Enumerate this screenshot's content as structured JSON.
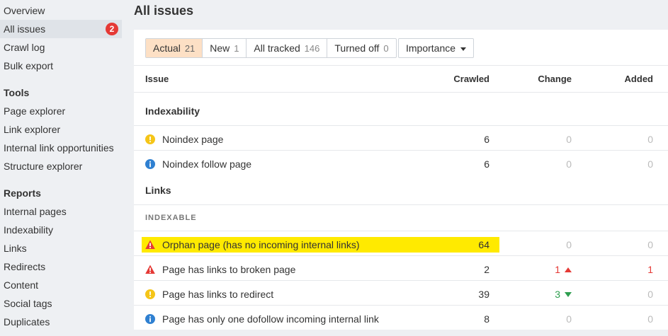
{
  "sidebar": {
    "items_top": [
      {
        "label": "Overview"
      },
      {
        "label": "All issues",
        "badge": "2",
        "active": true
      },
      {
        "label": "Crawl log"
      },
      {
        "label": "Bulk export"
      }
    ],
    "tools_heading": "Tools",
    "tools": [
      {
        "label": "Page explorer"
      },
      {
        "label": "Link explorer"
      },
      {
        "label": "Internal link opportunities"
      },
      {
        "label": "Structure explorer"
      }
    ],
    "reports_heading": "Reports",
    "reports": [
      {
        "label": "Internal pages"
      },
      {
        "label": "Indexability"
      },
      {
        "label": "Links"
      },
      {
        "label": "Redirects"
      },
      {
        "label": "Content"
      },
      {
        "label": "Social tags"
      },
      {
        "label": "Duplicates"
      }
    ]
  },
  "page_title": "All issues",
  "tabs": [
    {
      "label": "Actual",
      "count": "21",
      "active": true
    },
    {
      "label": "New",
      "count": "1"
    },
    {
      "label": "All tracked",
      "count": "146"
    },
    {
      "label": "Turned off",
      "count": "0"
    }
  ],
  "importance_label": "Importance",
  "table": {
    "headers": {
      "issue": "Issue",
      "crawled": "Crawled",
      "change": "Change",
      "added": "Added"
    },
    "sections": [
      {
        "title": "Indexability"
      },
      {
        "title": "Links",
        "subhead": "INDEXABLE"
      }
    ],
    "rows": [
      {
        "icon": "warning-yellow-icon",
        "issue": "Noindex page",
        "crawled": "6",
        "change": "0",
        "added": "0"
      },
      {
        "icon": "info-blue-icon",
        "issue": "Noindex follow page",
        "crawled": "6",
        "change": "0",
        "added": "0"
      },
      {
        "icon": "error-red-icon",
        "issue": "Orphan page (has no incoming internal links)",
        "crawled": "64",
        "change": "0",
        "added": "0",
        "highlighted": true
      },
      {
        "icon": "error-red-icon",
        "issue": "Page has links to broken page",
        "crawled": "2",
        "change": "1",
        "change_dir": "up",
        "added": "1"
      },
      {
        "icon": "warning-yellow-icon",
        "issue": "Page has links to redirect",
        "crawled": "39",
        "change": "3",
        "change_dir": "down",
        "added": "0"
      },
      {
        "icon": "info-blue-icon",
        "issue": "Page has only one dofollow incoming internal link",
        "crawled": "8",
        "change": "0",
        "added": "0"
      }
    ]
  },
  "colors": {
    "accent_tab": "#fde0c5",
    "highlight": "#ffea00",
    "error": "#e53935",
    "warning": "#f5c518",
    "info": "#2f80d1",
    "positive": "#2e9e4f"
  }
}
